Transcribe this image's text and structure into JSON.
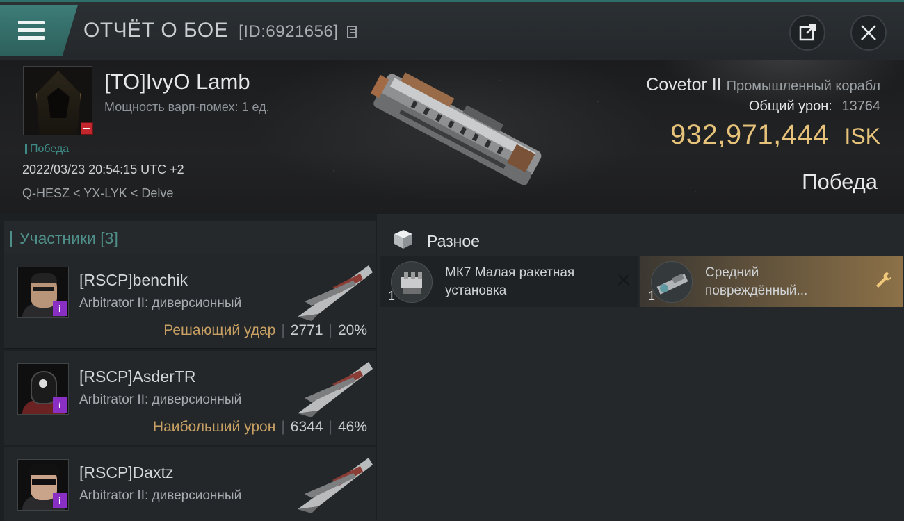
{
  "header": {
    "title": "ОТЧЁТ О БОЕ",
    "report_id": "[ID:6921656]",
    "icons": [
      "menu-icon",
      "copy-icon",
      "share-icon",
      "close-icon"
    ]
  },
  "victim": {
    "name": "[TO]IvyO Lamb",
    "warp_disruption": "Мощность варп-помех: 1 ед.",
    "status_tag": "Победа",
    "datetime": "2022/03/23 20:54:15 UTC +2",
    "location": "Q-HESZ < YX-LYK < Delve",
    "ship_name": "Covetor II",
    "ship_class": "Промышленный корабл",
    "damage_label": "Общий урон:",
    "damage_value": "13764",
    "isk_value": "932,971,444",
    "isk_unit": "ISK",
    "result": "Победа"
  },
  "participants": {
    "title": "Участники [3]",
    "rows": [
      {
        "name": "[RSCP]benchik",
        "ship": "Arbitrator II: диверсионный",
        "tag": "Решающий удар",
        "damage": "2771",
        "percent": "20%"
      },
      {
        "name": "[RSCP]AsderTR",
        "ship": "Arbitrator II: диверсионный",
        "tag": "Наибольший урон",
        "damage": "6344",
        "percent": "46%"
      },
      {
        "name": "[RSCP]Daxtz",
        "ship": "Arbitrator II: диверсионный",
        "tag": "",
        "damage": "",
        "percent": ""
      }
    ],
    "info_badge": "i"
  },
  "misc": {
    "title": "Разное",
    "items": [
      {
        "qty": "1",
        "name_line1": "МК7 Малая ракетная",
        "name_line2": "установка",
        "state": "destroyed"
      },
      {
        "qty": "1",
        "name_line1": "Средний",
        "name_line2": "повреждённый...",
        "state": "dropped"
      }
    ]
  },
  "colors": {
    "accent_teal": "#3e7d78",
    "isk_gold": "#e6c27a",
    "tag_gold": "#c8a063",
    "info_purple": "#8a2fc4",
    "loss_red": "#c3272d"
  }
}
